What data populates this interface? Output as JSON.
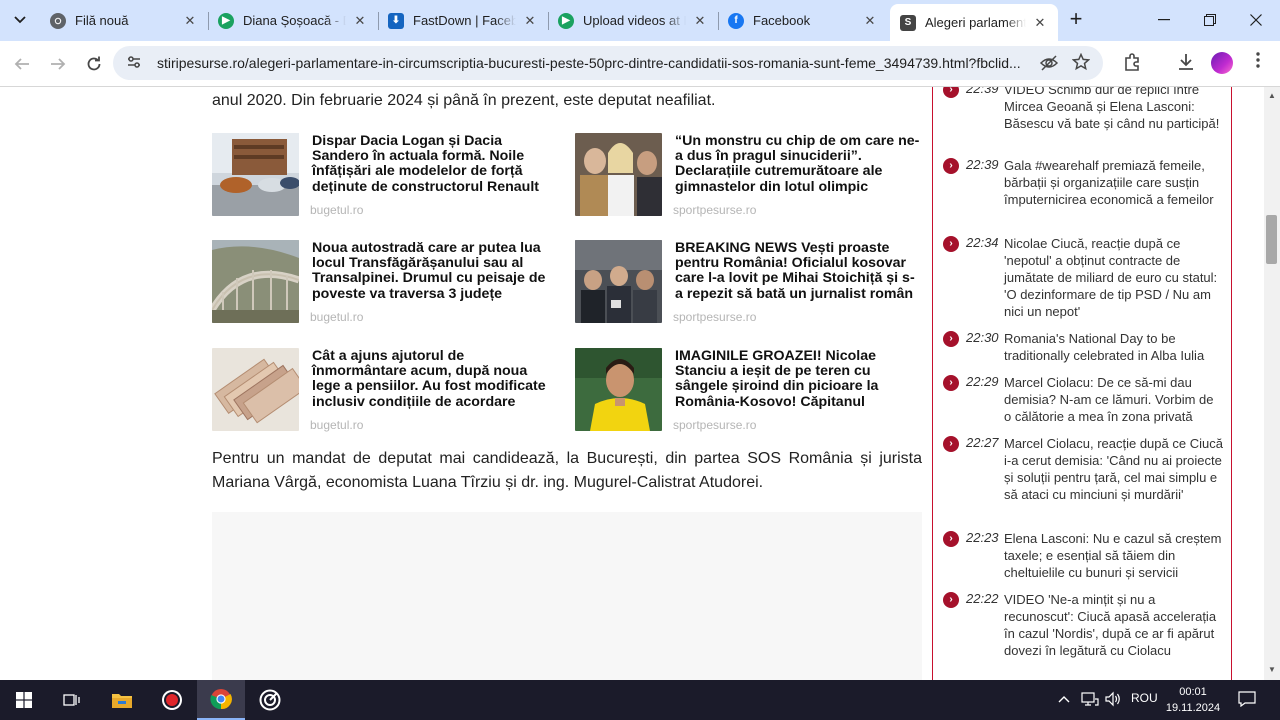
{
  "browser": {
    "tabs": [
      {
        "title": "Filă nouă",
        "icon": "chrome-icon",
        "color": "#5f6368"
      },
      {
        "title": "Diana Șoșoacă - D",
        "icon": "play-icon",
        "color": "#1aa260"
      },
      {
        "title": "FastDown | Facebo",
        "icon": "download-icon",
        "color": "#1565c0"
      },
      {
        "title": "Upload videos at F",
        "icon": "play-icon",
        "color": "#1aa260"
      },
      {
        "title": "Facebook",
        "icon": "facebook-icon",
        "color": "#1877f2"
      },
      {
        "title": "Alegeri parlamenta",
        "icon": "site-icon",
        "color": "#444444"
      }
    ],
    "active_tab": 5,
    "url": "stiripesurse.ro/alegeri-parlamentare-in-circumscriptia-bucuresti-peste-50prc-dintre-candidatii-sos-romania-sunt-feme_3494739.html?fbclid..."
  },
  "article": {
    "intro_line": "anul 2020. Din februarie 2024 și până în prezent, este deputat neafiliat.",
    "cards": [
      {
        "title": "Dispar Dacia Logan și Dacia Sandero în actuala formă. Noile înfățișări ale modelelor de forță deținute de constructorul Renault",
        "source": "bugetul.ro"
      },
      {
        "title": "“Un monstru cu chip de om care ne-a dus în pragul sinuciderii”. Declarațiile cutremurătoare ale gimnastelor din lotul olimpic",
        "source": "sportpesurse.ro"
      },
      {
        "title": "Noua autostradă care ar putea lua locul Transfăgărășanului sau al Transalpinei. Drumul cu peisaje de poveste va traversa 3 județe",
        "source": "bugetul.ro"
      },
      {
        "title": "BREAKING NEWS Vești proaste pentru România! Oficialul kosovar care l-a lovit pe Mihai Stoichiță și s-a repezit să bată un jurnalist român",
        "source": "sportpesurse.ro"
      },
      {
        "title": "Cât a ajuns ajutorul de înmormântare acum, după noua lege a pensiilor. Au fost modificate inclusiv condițiile de acordare",
        "source": "bugetul.ro"
      },
      {
        "title": "IMAGINILE GROAZEI! Nicolae Stanciu a ieșit de pe teren cu sângele șiroind din picioare la România-Kosovo! Căpitanul",
        "source": "sportpesurse.ro"
      }
    ],
    "paragraph": "Pentru un mandat de deputat mai candidează, la București, din partea SOS România și jurista Mariana Vârgă, economista Luana Tîrziu și dr. ing. Mugurel-Calistrat Atudorei."
  },
  "sidebar": {
    "news": [
      {
        "time": "22:39",
        "text": "VIDEO Schimb dur de replici între Mircea Geoană și Elena Lasconi: Băsescu vă bate și când nu participă!"
      },
      {
        "time": "22:39",
        "text": "Gala #wearehalf premiază femeile, bărbații și organizațiile care susțin împuternicirea economică a femeilor"
      },
      {
        "time": "22:34",
        "text": "Nicolae Ciucă, reacție după ce 'nepotul' a obținut contracte de jumătate de miliard de euro cu statul: 'O dezinformare de tip PSD / Nu am nici un nepot'"
      },
      {
        "time": "22:30",
        "text": "Romania's National Day to be traditionally celebrated in Alba Iulia"
      },
      {
        "time": "22:29",
        "text": "Marcel Ciolacu: De ce să-mi dau demisia? N-am ce lămuri. Vorbim de o călătorie a mea în zona privată"
      },
      {
        "time": "22:27",
        "text": "Marcel Ciolacu, reacție după ce Ciucă i-a cerut demisia: 'Când nu ai proiecte și soluții pentru țară, cel mai simplu e să ataci cu minciuni și murdării'"
      },
      {
        "time": "22:23",
        "text": "Elena Lasconi: Nu e cazul să creștem taxele; e esențial să tăiem din cheltuielile cu bunuri și servicii"
      },
      {
        "time": "22:22",
        "text": "VIDEO 'Ne-a mințit și nu a recunoscut': Ciucă apasă accelerația în cazul 'Nordis', după ce ar fi apărut dovezi în legătură cu Ciolacu"
      }
    ]
  },
  "taskbar": {
    "language": "ROU",
    "time": "00:01",
    "date": "19.11.2024"
  }
}
